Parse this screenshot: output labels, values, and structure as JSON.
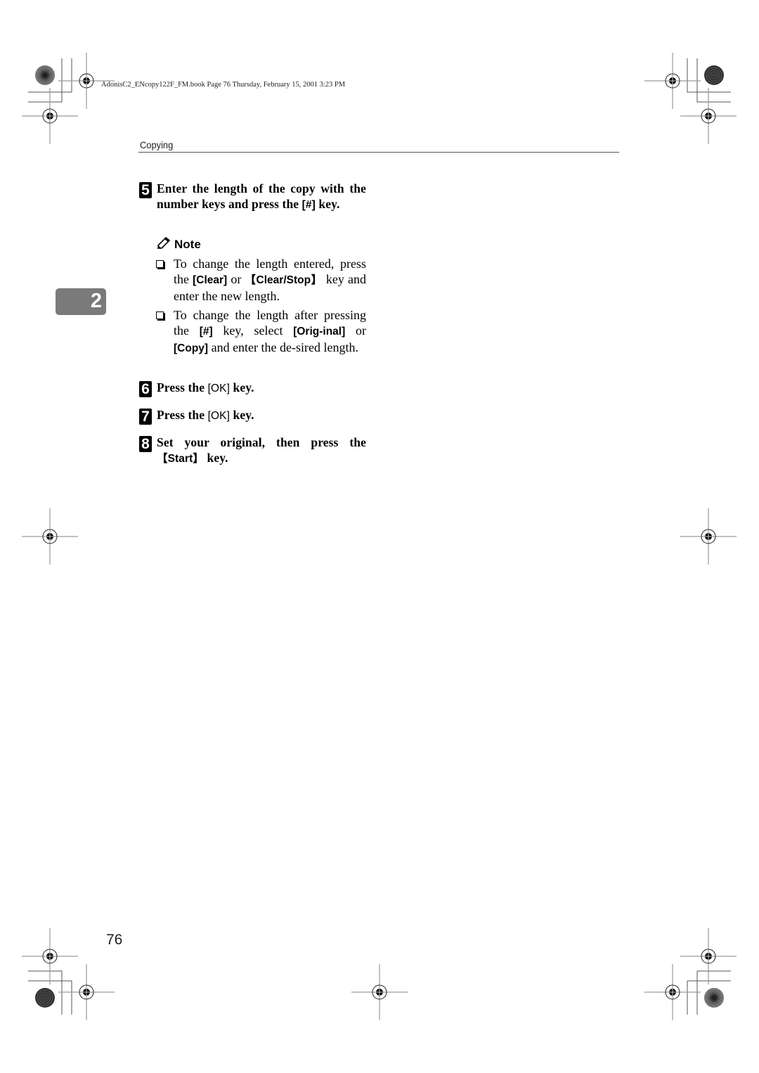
{
  "print_header": "AdonisC2_ENcopy122F_FM.book  Page 76  Thursday, February 15, 2001  3:23 PM",
  "section_title": "Copying",
  "chapter_tab": "2",
  "steps": [
    {
      "number": "5",
      "parts": [
        {
          "t": "Enter the length of the copy with the number keys and press the "
        },
        {
          "k": "[#]"
        },
        {
          "t": " key."
        }
      ]
    },
    {
      "number": "6",
      "parts": [
        {
          "t": "Press the "
        },
        {
          "kl": "[OK]"
        },
        {
          "t": " key."
        }
      ]
    },
    {
      "number": "7",
      "parts": [
        {
          "t": "Press the "
        },
        {
          "kl": "[OK]"
        },
        {
          "t": " key."
        }
      ]
    },
    {
      "number": "8",
      "parts": [
        {
          "t": "Set your original, then press the "
        },
        {
          "k": "【Start】"
        },
        {
          "t": " key."
        }
      ]
    }
  ],
  "note": {
    "heading": "Note",
    "icon": "pencil-icon",
    "bullets": [
      {
        "parts": [
          {
            "t": "To change the length entered, press the "
          },
          {
            "k": "[Clear]"
          },
          {
            "t": " or "
          },
          {
            "k": "【Clear/Stop】"
          },
          {
            "t": " key and enter the new length."
          }
        ]
      },
      {
        "parts": [
          {
            "t": "To change the length after pressing the "
          },
          {
            "k": "[#]"
          },
          {
            "t": " key, select "
          },
          {
            "k": "[Orig-inal]"
          },
          {
            "t": " or "
          },
          {
            "k": "[Copy]"
          },
          {
            "t": " and enter the de-sired length."
          }
        ]
      }
    ]
  },
  "page_number": "76"
}
